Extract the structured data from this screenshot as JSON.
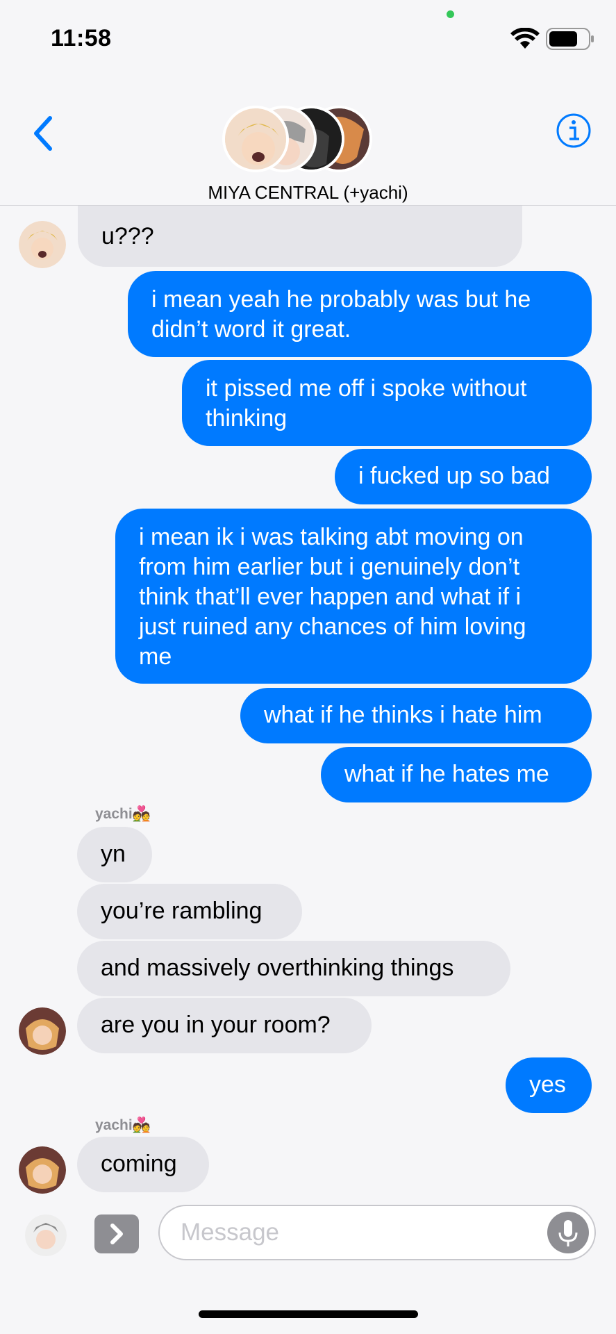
{
  "status": {
    "time": "11:58"
  },
  "header": {
    "group_name": "MIYA CENTRAL (+yachi)"
  },
  "messages": {
    "m0": "u care he wasn't just WORRIED abt u???",
    "m0_visible": "u???",
    "m1_l1": "i mean yeah he probably was but he",
    "m1_l2": "didn’t word it great.",
    "m2_l1": "it pissed me off i spoke without",
    "m2_l2": "thinking",
    "m3": "i fucked up so bad",
    "m4_l1": "i mean ik i was talking abt moving on",
    "m4_l2": "from him earlier but i genuinely don’t",
    "m4_l3": "think that’ll ever happen and what if i",
    "m4_l4": "just ruined any chances of him loving",
    "m4_l5": "me",
    "m5": "what if he thinks i hate him",
    "m6": "what if he hates me",
    "sender1": "yachi💑",
    "m7": "yn",
    "m8": "you’re rambling",
    "m9": "and massively overthinking things",
    "m10": "are you in your room?",
    "m11": "yes",
    "sender2": "yachi💑",
    "m12": "coming"
  },
  "composer": {
    "placeholder": "Message"
  },
  "colors": {
    "accent": "#007aff",
    "incoming": "#e5e5ea"
  }
}
